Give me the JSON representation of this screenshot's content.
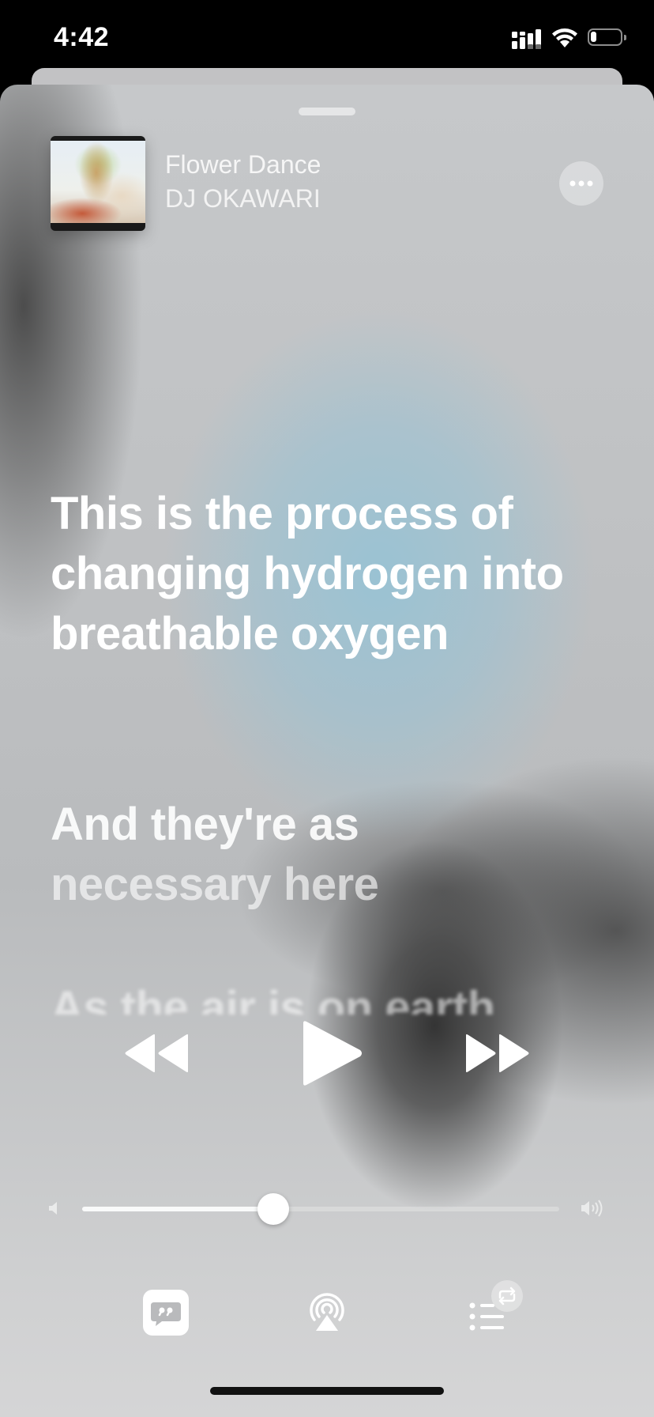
{
  "status_bar": {
    "time": "4:42",
    "battery_level": 0.2
  },
  "now_playing": {
    "title": "Flower Dance",
    "artist": "DJ OKAWARI"
  },
  "lyrics": {
    "current_line": "This is the process of changing hydrogen into breathable oxygen",
    "next_line_part1": "And they're as",
    "next_line_part2": "necessary here",
    "following_line": "As the air is on earth"
  },
  "playback": {
    "state": "paused",
    "volume": 0.4
  },
  "icons": {
    "more": "ellipsis-icon",
    "rewind": "rewind-icon",
    "play": "play-icon",
    "fast_forward": "fast-forward-icon",
    "volume_low": "speaker-low-icon",
    "volume_high": "speaker-high-icon",
    "lyrics": "lyrics-quote-icon",
    "airplay": "airplay-icon",
    "queue": "queue-list-icon",
    "repeat": "repeat-icon"
  },
  "colors": {
    "text": "#ffffff",
    "sheet_base": "#c6c8ca",
    "accent_blue": "#98c2d4"
  }
}
